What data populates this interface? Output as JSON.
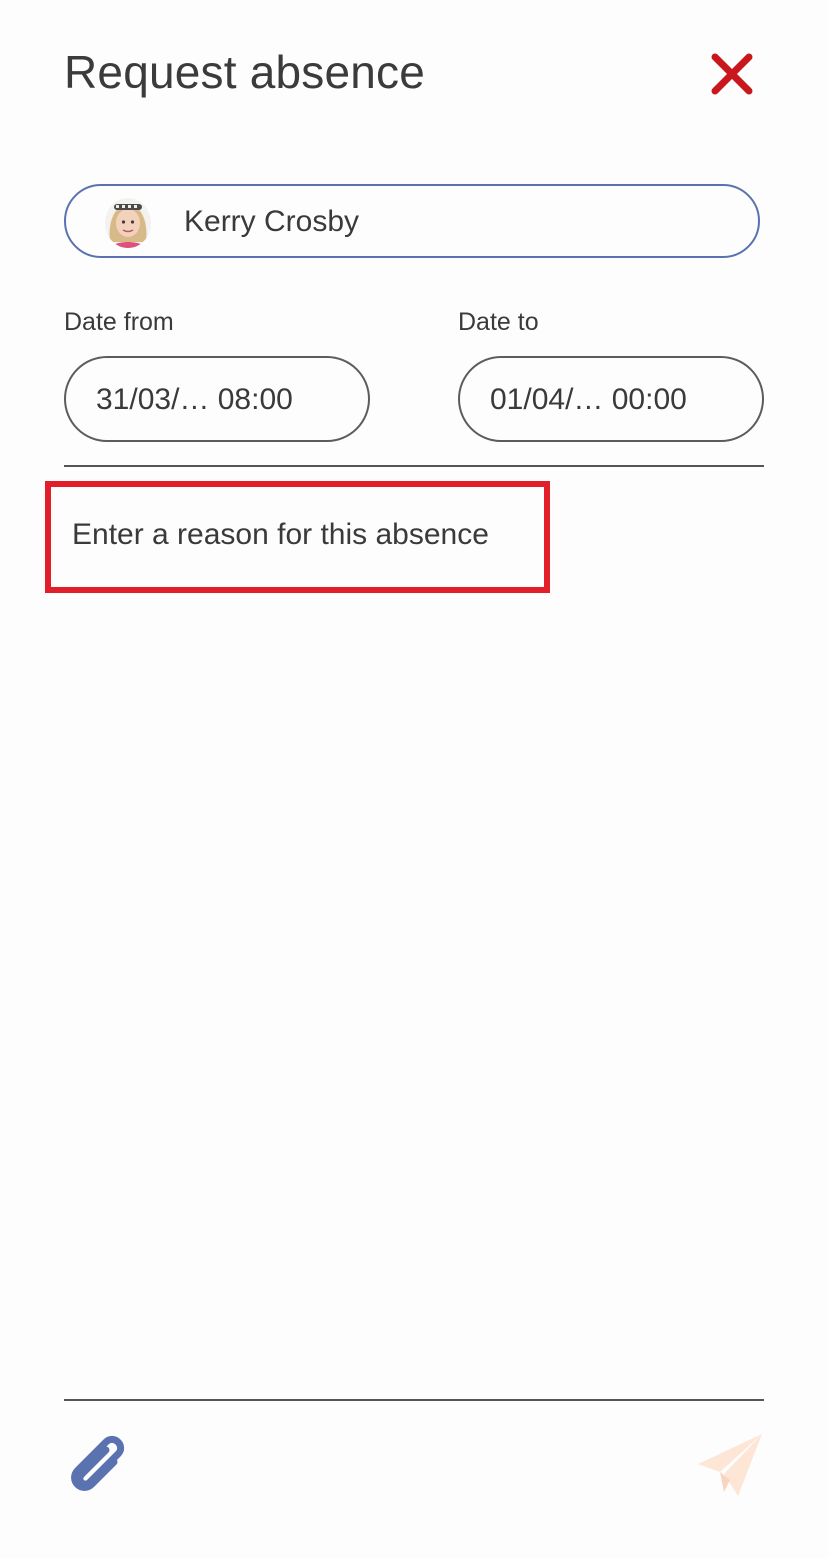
{
  "header": {
    "title": "Request absence"
  },
  "student": {
    "name": "Kerry Crosby"
  },
  "dates": {
    "from_label": "Date from",
    "from_value": "31/03/… 08:00",
    "to_label": "Date to",
    "to_value": "01/04/… 00:00"
  },
  "reason": {
    "placeholder": "Enter a reason for this absence"
  },
  "icons": {
    "close": "close-icon",
    "attach": "paperclip-icon",
    "send": "send-icon"
  },
  "colors": {
    "close": "#c8181e",
    "select_border": "#5a73b0",
    "highlight": "#e31e2b",
    "attach": "#5a73b0",
    "send": "#fde6d6"
  }
}
